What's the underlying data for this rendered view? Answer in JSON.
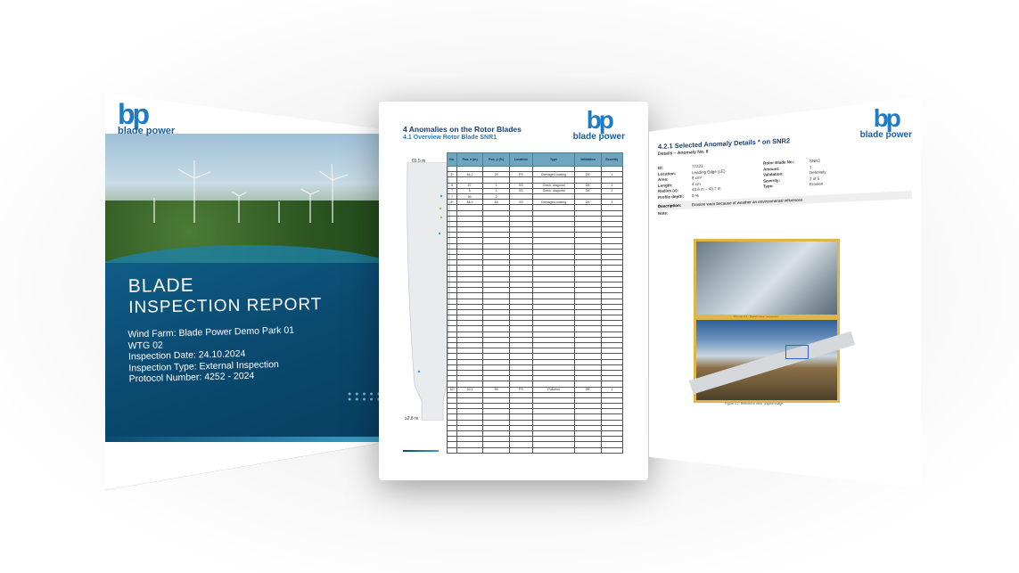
{
  "cover": {
    "logo_mark": "bp",
    "logo_text": "blade power",
    "title_line1": "BLADE",
    "title_line2": "INSPECTION REPORT",
    "info": [
      "Wind Farm: Blade Power Demo Park 01",
      "WTG 02",
      "Inspection Date: 24.10.2024",
      "Inspection Type: External Inspection",
      "Protocol Number: 4252 - 2024"
    ]
  },
  "table_page": {
    "logo_mark": "bp",
    "logo_text": "blade power",
    "heading": "4 Anomalies on the Rotor Blades",
    "subheading": "4.1 Overview Rotor Blade SNR1",
    "blade_length_top": "65.5 m",
    "blade_length_bottom": "≥2.8 m",
    "columns": [
      "No.",
      "Pos. z (m)",
      "Pos. y (%)",
      "Location",
      "Type",
      "Validation",
      "Severity"
    ],
    "rows": [
      [
        "",
        "",
        "",
        "",
        "",
        "",
        ""
      ],
      [
        "3*",
        "64.2",
        "29",
        "PS",
        "Damaged coating",
        "DE",
        "1"
      ],
      [
        "",
        "",
        "",
        "",
        "",
        "",
        ""
      ],
      [
        "6",
        "57.",
        "1",
        "SS",
        "Crack: diagonal",
        "DE",
        "1"
      ],
      [
        "7",
        "5.",
        "1",
        "SS",
        "Crack: diagonal",
        "DE",
        "1"
      ],
      [
        "7",
        "56.",
        "2",
        "",
        "",
        "",
        ""
      ],
      [
        "8*",
        "$6.0",
        "85",
        "SS",
        "Damaged coating",
        "DE",
        "1"
      ],
      [
        "10*",
        "20.1",
        "56",
        "PS",
        "Pollution",
        "DE",
        "1"
      ]
    ]
  },
  "detail_page": {
    "logo_mark": "bp",
    "logo_text": "blade power",
    "heading": "4.2.1 Selected Anomaly Details * on SNR2",
    "subheading": "Details – Anomaly No. 8",
    "fields_left": [
      {
        "k": "ID:",
        "v": "77223"
      },
      {
        "k": "Location:",
        "v": "Leading Edge (LE)"
      },
      {
        "k": "Area:",
        "v": "8 cm²"
      },
      {
        "k": "Length:",
        "v": "4 cm"
      },
      {
        "k": "Radius (z):",
        "v": "43.6 m – 43.7 m"
      },
      {
        "k": "Profile depth:",
        "v": "0 %"
      }
    ],
    "fields_right": [
      {
        "k": "Rotor Blade No.:",
        "v": "SNR2"
      },
      {
        "k": "Amount:",
        "v": "1"
      },
      {
        "k": "Validation:",
        "v": "Definitely"
      },
      {
        "k": "Severity:",
        "v": "2 of 5"
      },
      {
        "k": "Type:",
        "v": "Erosion"
      },
      {
        "k": "",
        "v": ""
      }
    ],
    "description_label": "Description:",
    "description": "Erosion wear because of weather an environmental influences",
    "note_label": "Note:",
    "caption1": "Figure 4.1: Detail view, anomaly.",
    "caption2": "Figure 4.2: Reference view, original image."
  },
  "colors": {
    "brand_blue": "#1e7bc4",
    "cover_blue": "#0b4a70",
    "table_header": "#6fa6bf",
    "photo_frame": "#e0b54a"
  }
}
